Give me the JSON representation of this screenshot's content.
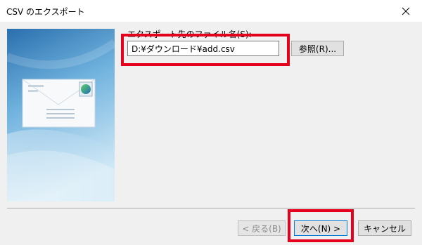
{
  "window": {
    "title": "CSV のエクスポート",
    "close_icon": "close-icon"
  },
  "export": {
    "field_label": "エクスポート先のファイル名(S):",
    "path_value": "D:¥ダウンロード¥add.csv",
    "browse_label": "参照(R)..."
  },
  "footer": {
    "back_label": "< 戻る(B)",
    "next_label": "次へ(N) >",
    "cancel_label": "キャンセル"
  },
  "colors": {
    "highlight": "#e5001e",
    "accent": "#0078d7",
    "dialog_bg": "#f0f0f0"
  }
}
